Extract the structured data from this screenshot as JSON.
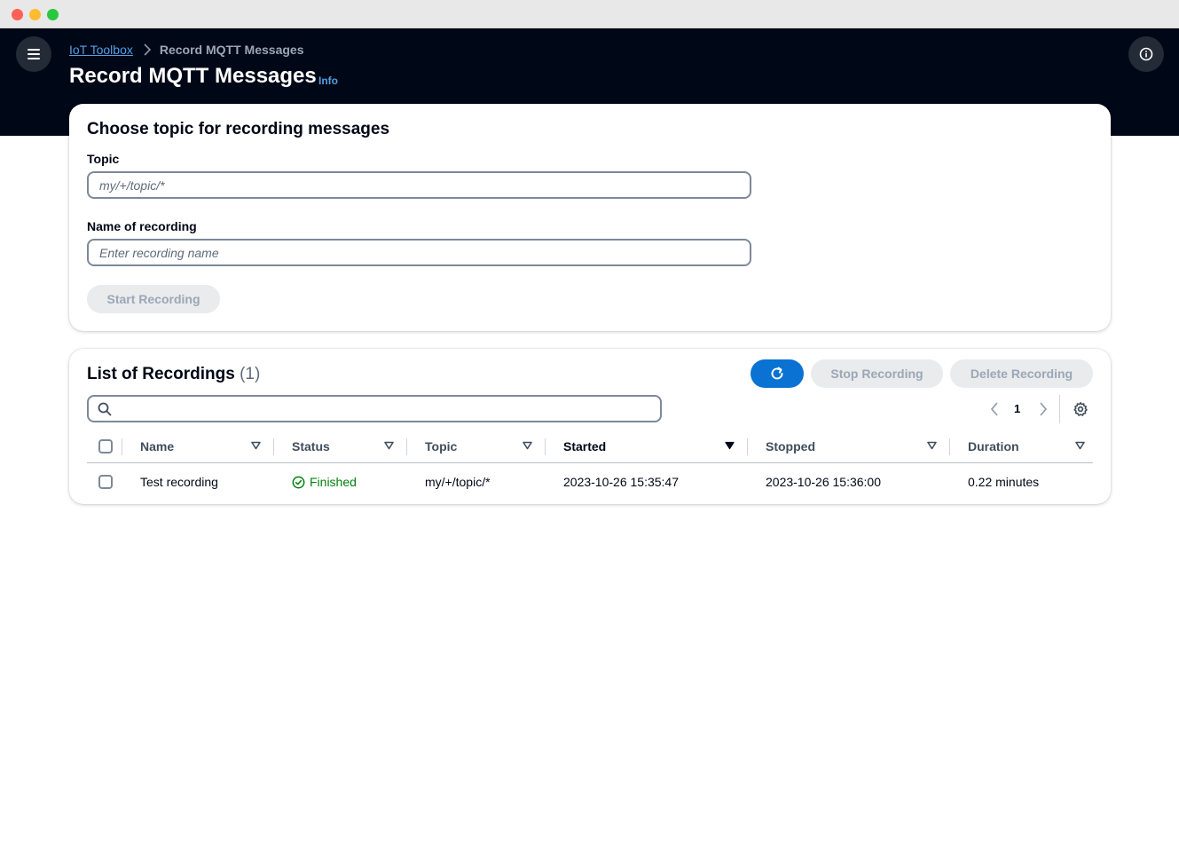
{
  "header": {
    "breadcrumb": {
      "root": "IoT Toolbox",
      "current": "Record MQTT Messages"
    },
    "title": "Record MQTT Messages",
    "info_label": "Info"
  },
  "recording_form": {
    "title": "Choose topic for recording messages",
    "topic_label": "Topic",
    "topic_placeholder": "my/+/topic/*",
    "name_label": "Name of recording",
    "name_placeholder": "Enter recording name",
    "start_button": "Start Recording"
  },
  "recordings": {
    "title": "List of Recordings",
    "count": "(1)",
    "stop_button": "Stop Recording",
    "delete_button": "Delete Recording",
    "search_value": "",
    "current_page": "1",
    "columns": [
      "Name",
      "Status",
      "Topic",
      "Started",
      "Stopped",
      "Duration"
    ],
    "sorted_column": "Started",
    "rows": [
      {
        "name": "Test recording",
        "status": "Finished",
        "topic": "my/+/topic/*",
        "started": "2023-10-26 15:35:47",
        "stopped": "2023-10-26 15:36:00",
        "duration": "0.22 minutes"
      }
    ]
  },
  "icons": {
    "menu": "hamburger-menu-icon",
    "info": "info-circle-icon",
    "refresh": "refresh-icon",
    "search": "search-icon",
    "settings": "gear-icon",
    "status": "check-circle-icon"
  },
  "colors": {
    "header_bg": "#000716",
    "primary": "#0972d3",
    "link": "#539fe5",
    "success": "#037f0c",
    "disabled_bg": "#e9ebed"
  }
}
